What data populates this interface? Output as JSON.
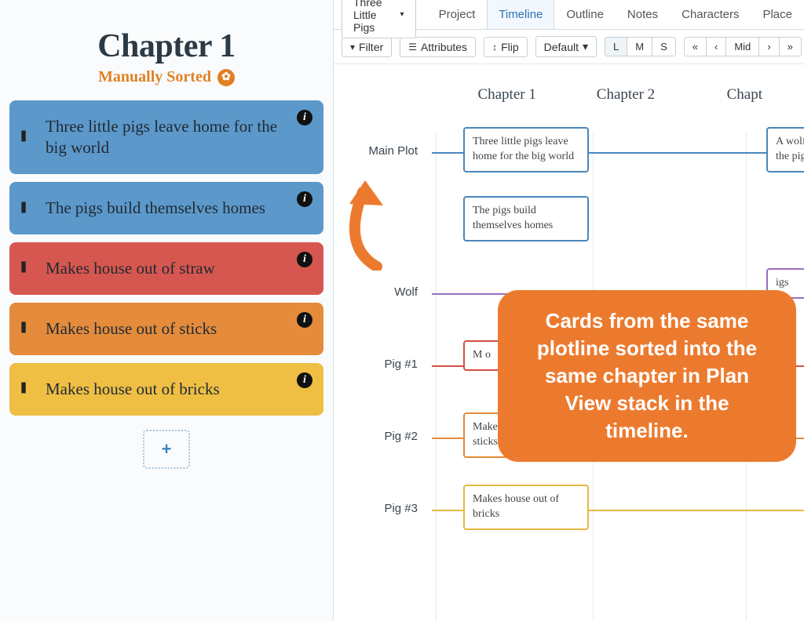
{
  "plan_panel": {
    "title": "Chapter 1",
    "sort_mode": "Manually Sorted",
    "sort_icon": "✿",
    "cards": [
      {
        "text": "Three little pigs leave home for the big world",
        "color": "c-blue"
      },
      {
        "text": "The pigs build themselves homes",
        "color": "c-blue"
      },
      {
        "text": "Makes house out of straw",
        "color": "c-red"
      },
      {
        "text": "Makes house out of sticks",
        "color": "c-orange"
      },
      {
        "text": "Makes house out of bricks",
        "color": "c-yellow"
      }
    ],
    "add_label": "+"
  },
  "timeline": {
    "project_name": "Three Little Pigs",
    "tabs": [
      "Project",
      "Timeline",
      "Outline",
      "Notes",
      "Characters",
      "Place"
    ],
    "active_tab": "Timeline",
    "toolbar": {
      "filter": "Filter",
      "attributes": "Attributes",
      "flip": "Flip",
      "default": "Default",
      "sizes": [
        "L",
        "M",
        "S"
      ],
      "active_size": "L",
      "nav": [
        "«",
        "‹",
        "Mid",
        "›",
        "»"
      ]
    },
    "chapters": [
      "Chapter 1",
      "Chapter 2",
      "Chapt"
    ],
    "lanes": [
      {
        "name": "Main Plot",
        "color": "ll-blue"
      },
      {
        "name": "Wolf",
        "color": "ll-purple"
      },
      {
        "name": "Pig #1",
        "color": "ll-red"
      },
      {
        "name": "Pig #2",
        "color": "ll-orange"
      },
      {
        "name": "Pig #3",
        "color": "ll-yellow"
      }
    ],
    "tcards": {
      "mp1": "Three little pigs leave home for the big world",
      "mp2": "The pigs build themselves homes",
      "mp3": "A wolf pass the pigs' ho",
      "wolf1": "igs",
      "p1": "M  o",
      "p2": "Makes of sticks",
      "p3": "Makes house out of bricks"
    }
  },
  "callout": "Cards from the same plotline sorted into the same chapter in Plan View stack in the timeline."
}
